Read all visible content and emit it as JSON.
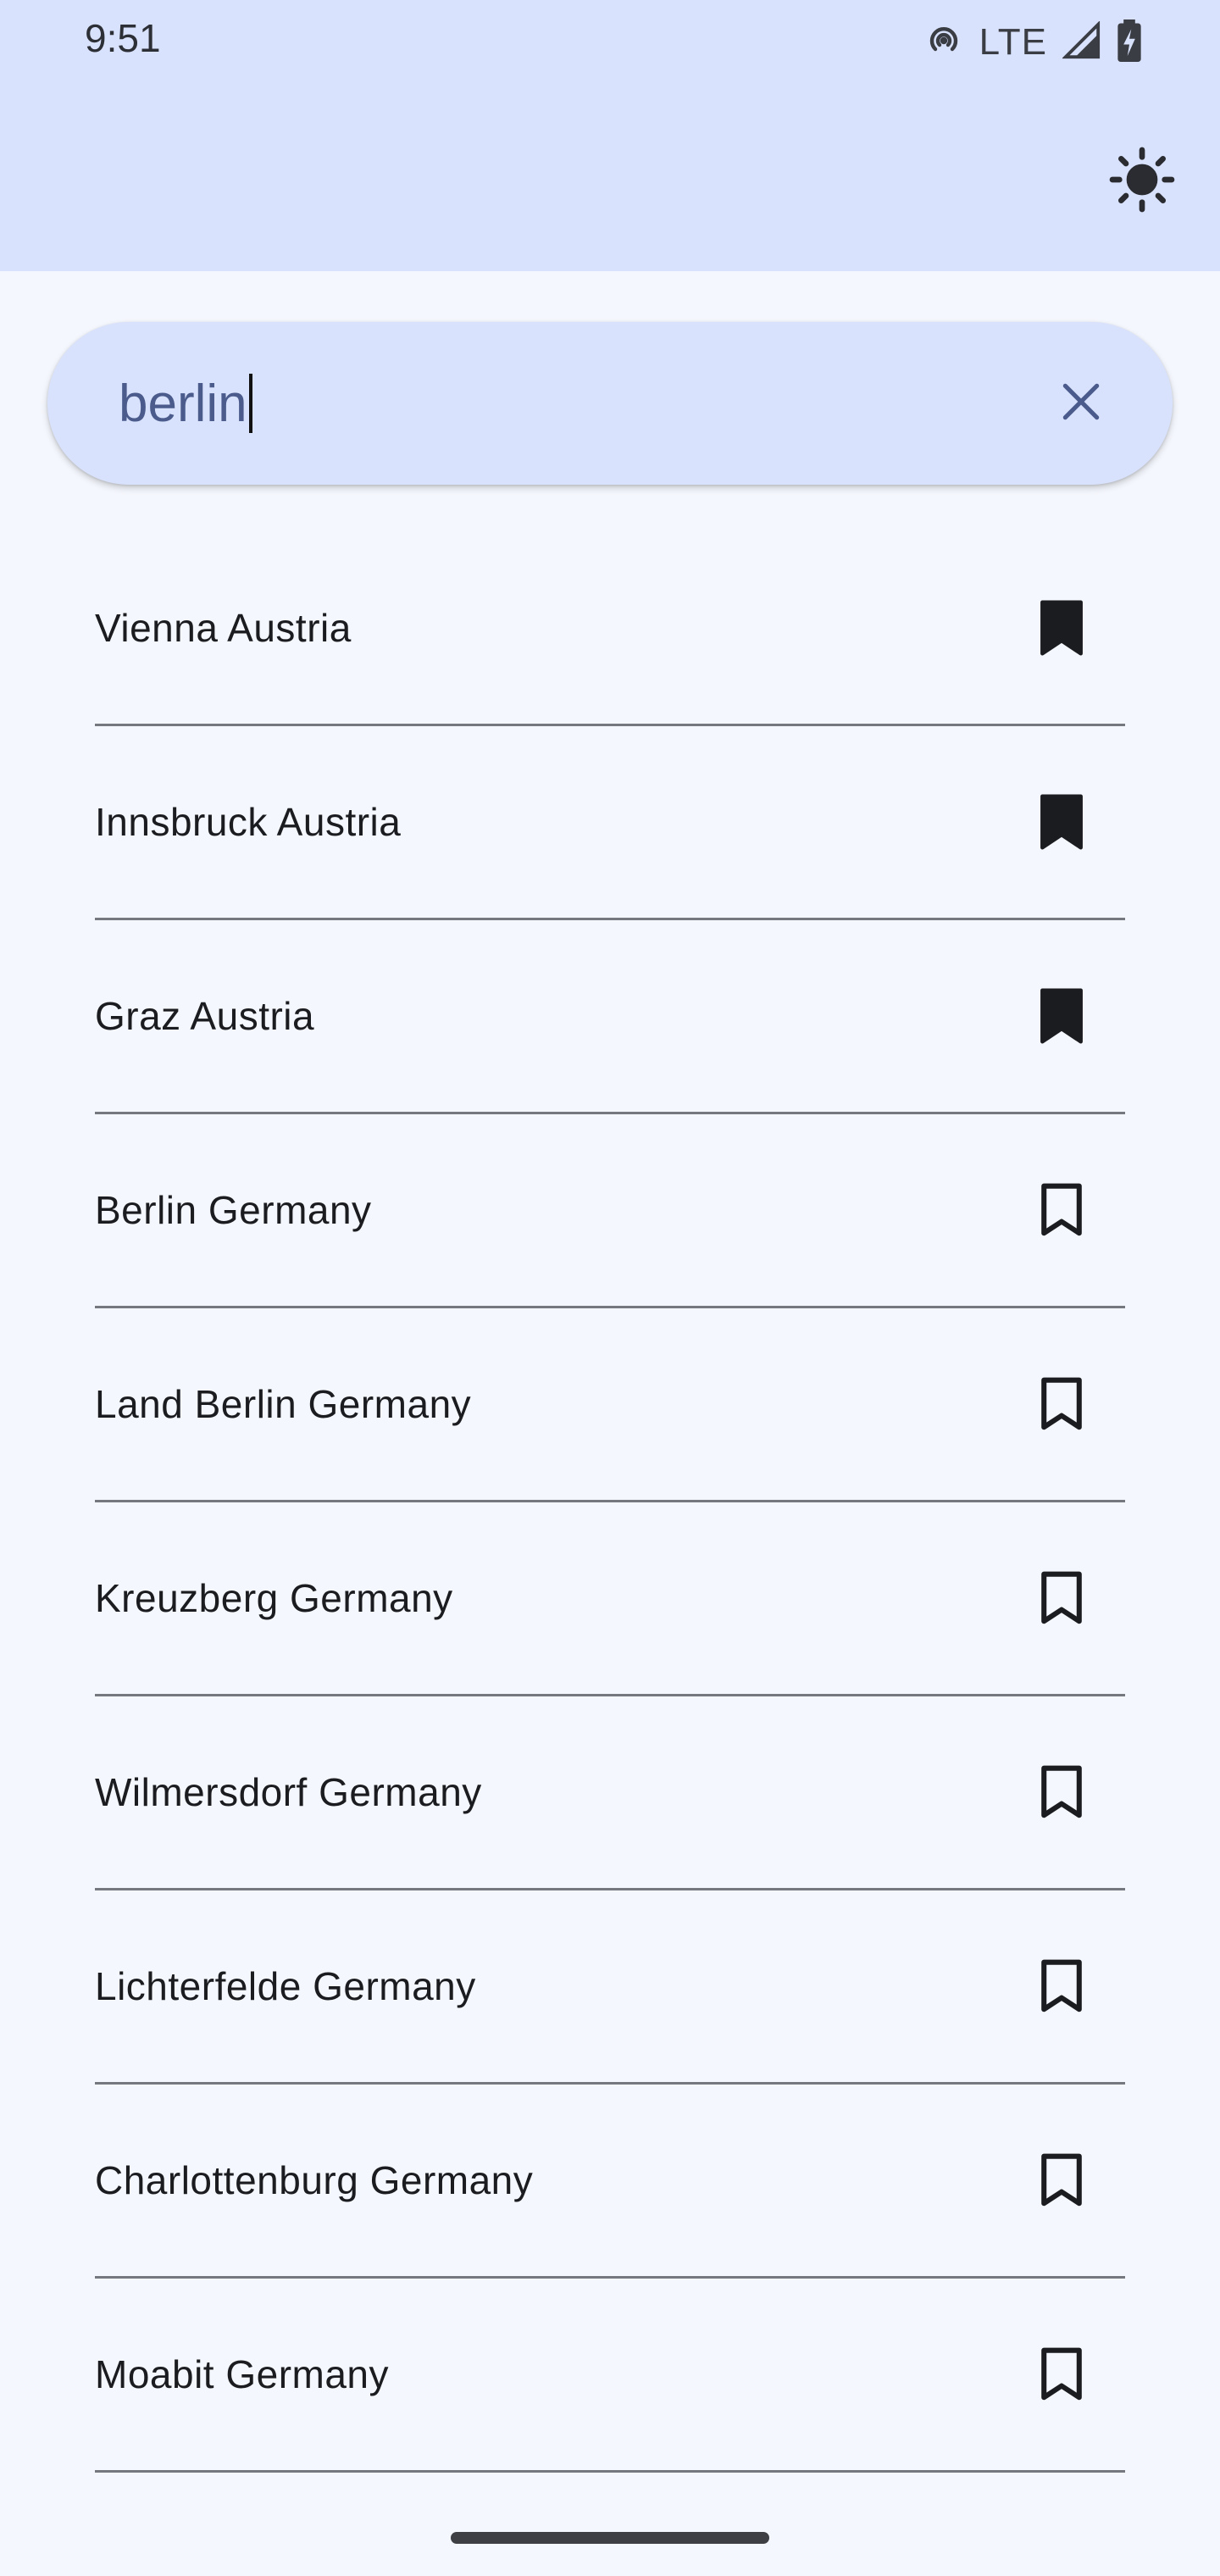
{
  "status_bar": {
    "time": "9:51",
    "network": "LTE",
    "icons": [
      "hotspot-icon",
      "signal-icon",
      "battery-charging-icon"
    ]
  },
  "app_bar": {
    "theme_icon": "sun-icon"
  },
  "search": {
    "value": "berlin",
    "clear_icon": "close-icon"
  },
  "results": [
    {
      "label": "Vienna Austria",
      "bookmarked": true
    },
    {
      "label": "Innsbruck Austria",
      "bookmarked": true
    },
    {
      "label": "Graz Austria",
      "bookmarked": true
    },
    {
      "label": "Berlin Germany",
      "bookmarked": false
    },
    {
      "label": "Land Berlin Germany",
      "bookmarked": false
    },
    {
      "label": "Kreuzberg Germany",
      "bookmarked": false
    },
    {
      "label": "Wilmersdorf Germany",
      "bookmarked": false
    },
    {
      "label": "Lichterfelde Germany",
      "bookmarked": false
    },
    {
      "label": "Charlottenburg Germany",
      "bookmarked": false
    },
    {
      "label": "Moabit Germany",
      "bookmarked": false
    }
  ],
  "colors": {
    "app_bar": "#d9e2fc",
    "background": "#f4f7fd",
    "search_text": "#4a5b8c",
    "divider": "#76787f",
    "icon": "#1b1c20"
  }
}
